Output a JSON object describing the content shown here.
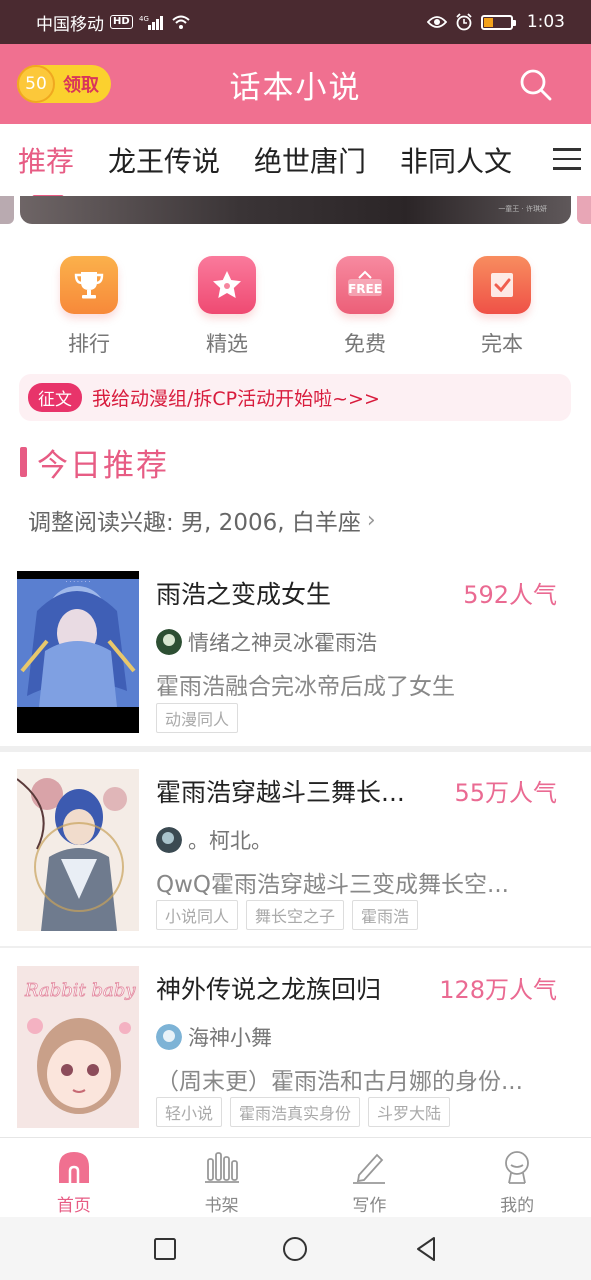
{
  "status_bar": {
    "carrier": "中国移动",
    "hd": "HD",
    "network": "4G",
    "time": "1:03"
  },
  "header": {
    "title": "话本小说",
    "coin_count": "50",
    "claim_label": "领取"
  },
  "tabs": [
    {
      "label": "推荐",
      "active": true
    },
    {
      "label": "龙王传说",
      "active": false
    },
    {
      "label": "绝世唐门",
      "active": false
    },
    {
      "label": "非同人文",
      "active": false
    }
  ],
  "quick_entries": [
    {
      "label": "排行",
      "icon": "trophy-icon",
      "color": "#f7943a"
    },
    {
      "label": "精选",
      "icon": "star-icon",
      "color": "#f2577e"
    },
    {
      "label": "免费",
      "icon": "free-icon",
      "color": "#f06e83",
      "icon_text": "FREE"
    },
    {
      "label": "完本",
      "icon": "check-book-icon",
      "color": "#f26a4f"
    }
  ],
  "notice": {
    "badge": "征文",
    "text": "我给动漫组/拆CP活动开始啦~>>"
  },
  "section": {
    "title": "今日推荐",
    "interest": "调整阅读兴趣: 男, 2006, 白羊座"
  },
  "books": [
    {
      "title": "雨浩之变成女生",
      "popularity": "592人气",
      "author": "情绪之神灵冰霍雨浩",
      "description": "霍雨浩融合完冰帝后成了女生",
      "tags": [
        "动漫同人"
      ]
    },
    {
      "title": "霍雨浩穿越斗三舞长...",
      "popularity": "55万人气",
      "author": "。柯北。",
      "description": "QwQ霍雨浩穿越斗三变成舞长空...",
      "tags": [
        "小说同人",
        "舞长空之子",
        "霍雨浩"
      ]
    },
    {
      "title": "神外传说之龙族回归",
      "popularity": "128万人气",
      "author": "海神小舞",
      "description": "（周末更）霍雨浩和古月娜的身份...",
      "tags": [
        "轻小说",
        "霍雨浩真实身份",
        "斗罗大陆"
      ]
    }
  ],
  "bottom_nav": [
    {
      "label": "首页",
      "icon": "home-icon",
      "active": true
    },
    {
      "label": "书架",
      "icon": "bookshelf-icon",
      "active": false
    },
    {
      "label": "写作",
      "icon": "pen-icon",
      "active": false
    },
    {
      "label": "我的",
      "icon": "profile-icon",
      "active": false
    }
  ],
  "colors": {
    "brand": "#f07090",
    "accent": "#e75c84",
    "status_bar": "#4a2a30"
  }
}
